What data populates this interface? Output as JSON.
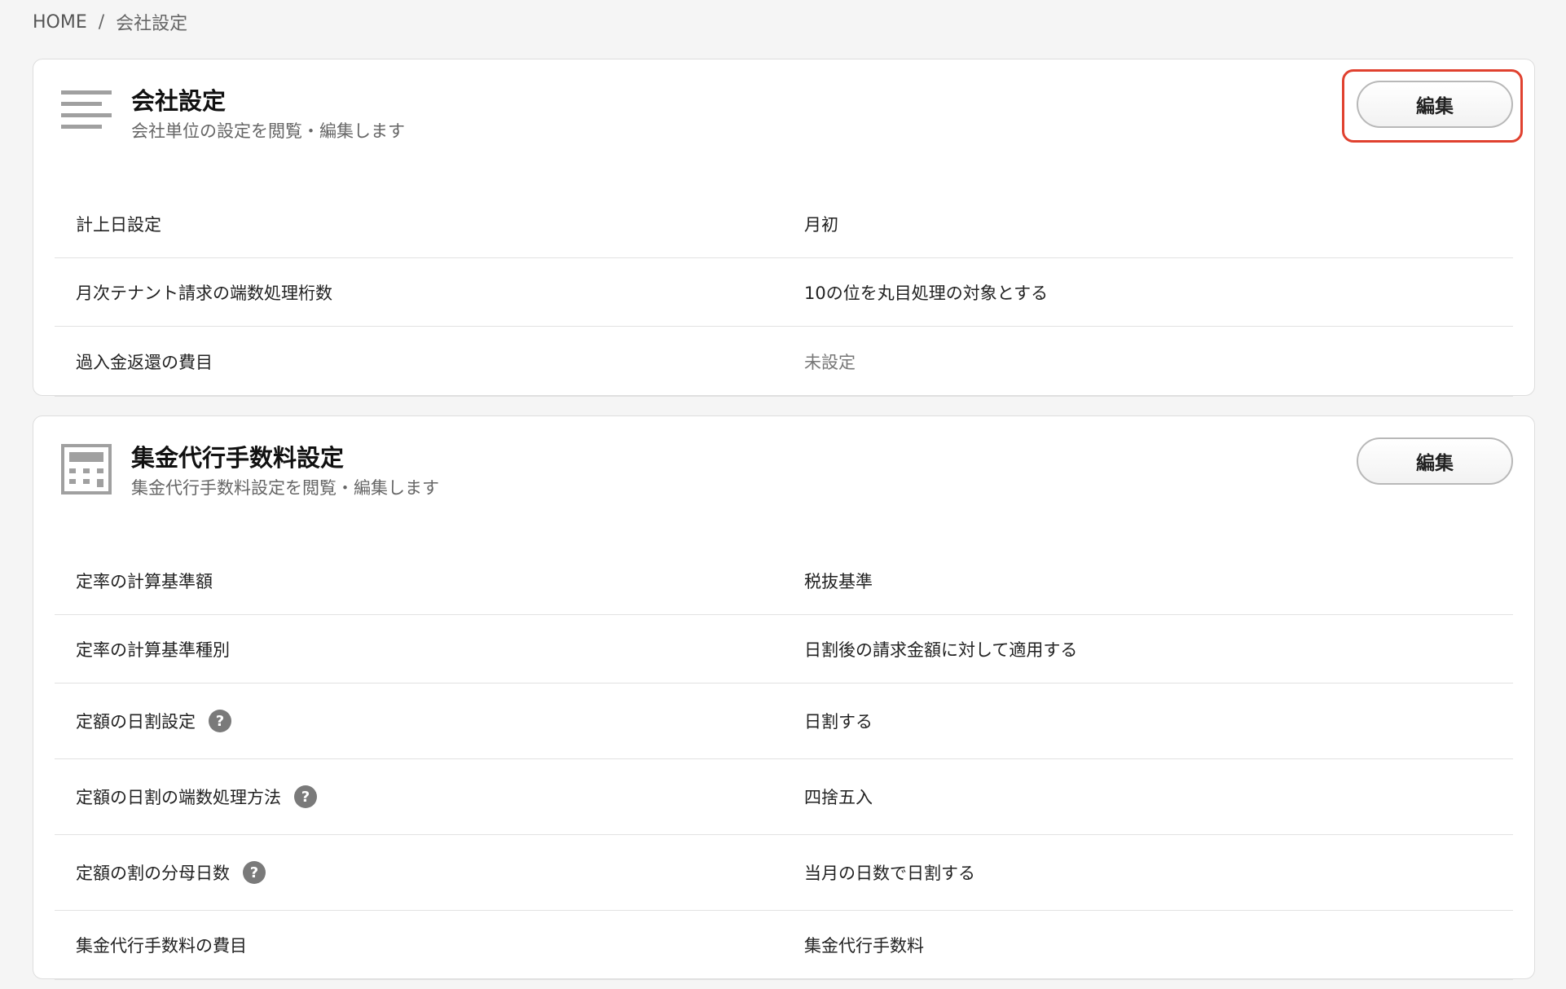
{
  "breadcrumb": {
    "home": "HOME",
    "separator": "/",
    "current": "会社設定"
  },
  "company_settings": {
    "icon": "list-lines-icon",
    "title": "会社設定",
    "subtitle": "会社単位の設定を閲覧・編集します",
    "edit_label": "編集",
    "rows": [
      {
        "label": "計上日設定",
        "value": "月初"
      },
      {
        "label": "月次テナント請求の端数処理桁数",
        "value": "10の位を丸目処理の対象とする"
      },
      {
        "label": "過入金返還の費目",
        "value": "未設定"
      }
    ]
  },
  "collection_fee_settings": {
    "icon": "calculator-icon",
    "title": "集金代行手数料設定",
    "subtitle": "集金代行手数料設定を閲覧・編集します",
    "edit_label": "編集",
    "rows": [
      {
        "label": "定率の計算基準額",
        "value": "税抜基準"
      },
      {
        "label": "定率の計算基準種別",
        "value": "日割後の請求金額に対して適用する"
      },
      {
        "label": "定額の日割設定",
        "value": "日割する",
        "help": "?"
      },
      {
        "label": "定額の日割の端数処理方法",
        "value": "四捨五入",
        "help": "?"
      },
      {
        "label": "定額の割の分母日数",
        "value": "当月の日数で日割する",
        "help": "?"
      },
      {
        "label": "集金代行手数料の費目",
        "value": "集金代行手数料"
      }
    ]
  },
  "colors": {
    "highlight": "#e0412f",
    "background": "#f5f5f5",
    "icon_gray": "#a0a0a0"
  }
}
